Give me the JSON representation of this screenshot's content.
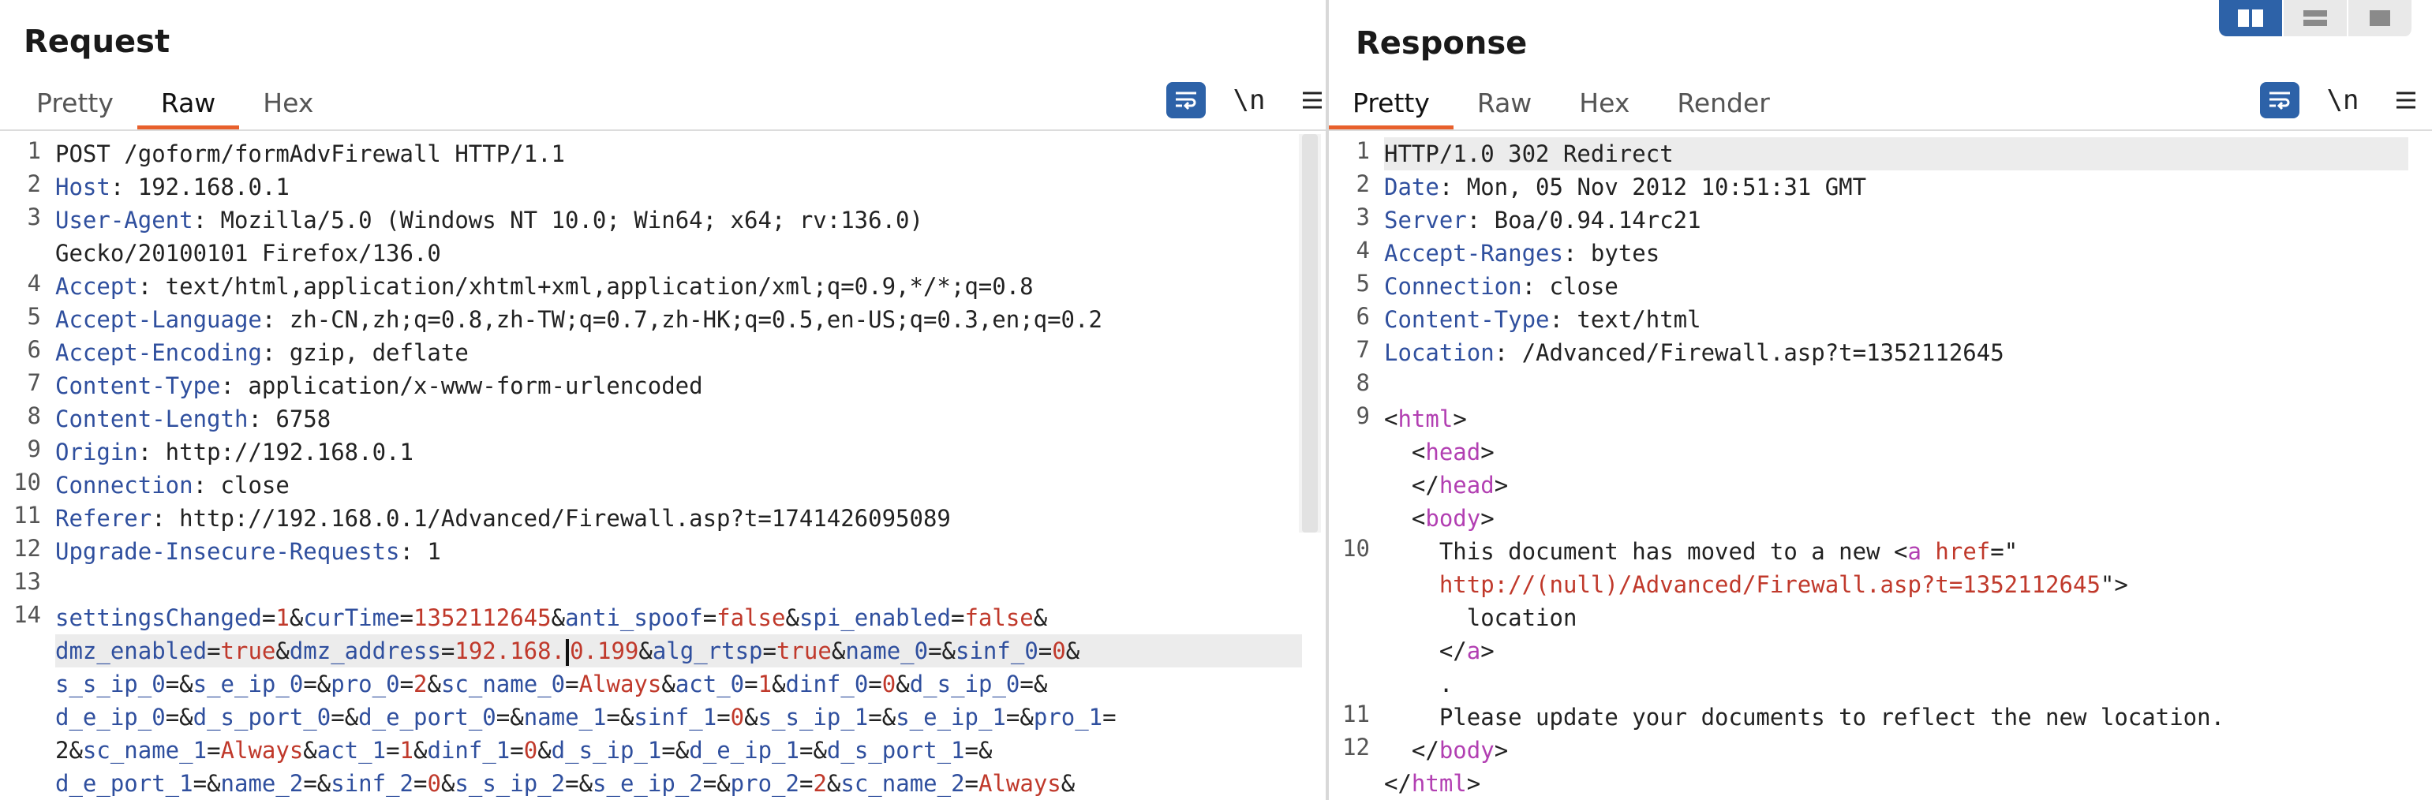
{
  "request": {
    "title": "Request",
    "tabs": [
      {
        "label": "Pretty"
      },
      {
        "label": "Raw"
      },
      {
        "label": "Hex"
      }
    ],
    "active_tab": "Raw",
    "newline_label": "\\n",
    "line_numbers": [
      "1",
      "2",
      "3",
      "4",
      "5",
      "6",
      "7",
      "8",
      "9",
      "10",
      "11",
      "12",
      "13",
      "14"
    ],
    "lines": [
      "POST /goform/formAdvFirewall HTTP/1.1",
      "Host: 192.168.0.1",
      "User-Agent: Mozilla/5.0 (Windows NT 10.0; Win64; x64; rv:136.0)",
      "Gecko/20100101 Firefox/136.0",
      "Accept: text/html,application/xhtml+xml,application/xml;q=0.9,*/*;q=0.8",
      "Accept-Language: zh-CN,zh;q=0.8,zh-TW;q=0.7,zh-HK;q=0.5,en-US;q=0.3,en;q=0.2",
      "Accept-Encoding: gzip, deflate",
      "Content-Type: application/x-www-form-urlencoded",
      "Content-Length: 6758",
      "Origin: http://192.168.0.1",
      "Connection: close",
      "Referer: http://192.168.0.1/Advanced/Firewall.asp?t=1741426095089",
      "Upgrade-Insecure-Requests: 1",
      "",
      "settingsChanged=1&curTime=1352112645&anti_spoof=false&spi_enabled=false&",
      "dmz_enabled=true&dmz_address=192.168.0.199&alg_rtsp=true&name_0=&sinf_0=0&",
      "s_s_ip_0=&s_e_ip_0=&pro_0=2&sc_name_0=Always&act_0=1&dinf_0=0&d_s_ip_0=&",
      "d_e_ip_0=&d_s_port_0=&d_e_port_0=&name_1=&sinf_1=0&s_s_ip_1=&s_e_ip_1=&pro_1=",
      "2&sc_name_1=Always&act_1=1&dinf_1=0&d_s_ip_1=&d_e_ip_1=&d_s_port_1=&",
      "d_e_port_1=&name_2=&sinf_2=0&s_s_ip_2=&s_e_ip_2=&pro_2=2&sc_name_2=Always&"
    ]
  },
  "response": {
    "title": "Response",
    "tabs": [
      {
        "label": "Pretty"
      },
      {
        "label": "Raw"
      },
      {
        "label": "Hex"
      },
      {
        "label": "Render"
      }
    ],
    "active_tab": "Pretty",
    "newline_label": "\\n",
    "line_numbers": [
      "1",
      "2",
      "3",
      "4",
      "5",
      "6",
      "7",
      "8",
      "9",
      "10",
      "11",
      "12"
    ],
    "lines": [
      "HTTP/1.0 302 Redirect",
      "Date: Mon, 05 Nov 2012 10:51:31 GMT",
      "Server: Boa/0.94.14rc21",
      "Accept-Ranges: bytes",
      "Connection: close",
      "Content-Type: text/html",
      "Location: /Advanced/Firewall.asp?t=1352112645",
      "",
      "<html>",
      "  <head>",
      "  </head>",
      "  <body>",
      "    This document has moved to a new <a href=\"",
      "    http://(null)/Advanced/Firewall.asp?t=1352112645\">",
      "      location",
      "    </a>",
      "    .",
      "    Please update your documents to reflect the new location.",
      "  </body>",
      "</html>"
    ]
  },
  "colors": {
    "accent": "#e8602c",
    "key": "#2f4f9e",
    "value": "#c0392b",
    "tag": "#b23fb2",
    "button": "#2d62a8"
  }
}
